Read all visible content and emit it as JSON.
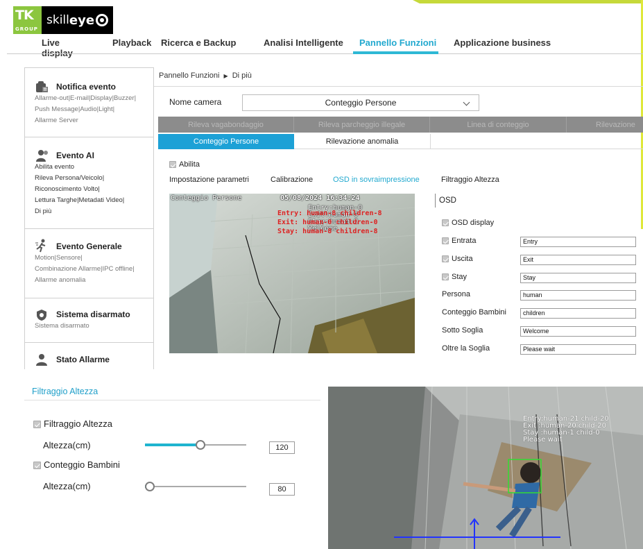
{
  "brand": {
    "logo_mark": "TK",
    "logo_group": "GROUP",
    "product_prefix": "skill",
    "product_name": "eye"
  },
  "main_nav": [
    {
      "label": "Live display"
    },
    {
      "label": "Playback"
    },
    {
      "label": "Ricerca e Backup"
    },
    {
      "label": "Analisi Intelligente"
    },
    {
      "label": "Pannello Funzioni",
      "active": true
    },
    {
      "label": "Applicazione business"
    }
  ],
  "sidebar": [
    {
      "title": "Notifica evento",
      "icon": "bell-icon",
      "items": [
        "Allarme-out|E-mail|Display|Buzzer|",
        "Push Message|Audio|Light|",
        "Allarme Server"
      ]
    },
    {
      "title": "Evento AI",
      "icon": "ai-person-icon",
      "items": [
        "Abilita evento",
        "Rileva Persona/Veicolo|",
        "Riconoscimento Volto|",
        "Lettura Targhe|Metadati Video|",
        "Di più"
      ]
    },
    {
      "title": "Evento Generale",
      "icon": "motion-person-icon",
      "items": [
        "Motion|Sensore|",
        "Combinazione Allarme|IPC offline|",
        "Allarme anomalia"
      ]
    },
    {
      "title": "Sistema disarmato",
      "icon": "shield-icon",
      "items": [
        "Sistema disarmato"
      ]
    },
    {
      "title": "Stato Allarme",
      "icon": "alarm-status-icon",
      "items": []
    }
  ],
  "breadcrumb": {
    "root": "Pannello Funzioni",
    "separator": "▶",
    "current": "Di più"
  },
  "camera": {
    "label": "Nome camera",
    "selected": "Conteggio Persone"
  },
  "tabs_row1": [
    "Rileva vagabondaggio",
    "Rileva parcheggio illegale",
    "Linea di conteggio",
    "Rilevazione"
  ],
  "tabs_row2": [
    {
      "label": "Conteggio Persone",
      "active": true
    },
    {
      "label": "Rilevazione anomalia",
      "active": false
    }
  ],
  "abilita": {
    "label": "Abilita",
    "checked": true
  },
  "subtabs": [
    {
      "label": "Impostazione parametri",
      "active": false
    },
    {
      "label": "Calibrazione",
      "active": false
    },
    {
      "label": "OSD in sovraimpressione",
      "active": true
    },
    {
      "label": "Filtraggio Altezza",
      "active": false
    }
  ],
  "video_overlay": {
    "channel": "Conteggio Persone",
    "timestamp": "05/08/2024 16:34:24",
    "red_lines": [
      "Entry: human-8 children-8",
      "Exit: human-0 children-0",
      "Stay: human-8 children-8"
    ],
    "white_lines": [
      "Entry:human-0",
      "Exit:human-0",
      "Stay:human-0",
      "Welcome"
    ]
  },
  "osd": {
    "title": "OSD",
    "display": {
      "label": "OSD display",
      "checked": true
    },
    "fields": [
      {
        "label": "Entrata",
        "checkbox": true,
        "value": "Entry"
      },
      {
        "label": "Uscita",
        "checkbox": true,
        "value": "Exit"
      },
      {
        "label": "Stay",
        "checkbox": true,
        "value": "Stay"
      },
      {
        "label": "Persona",
        "checkbox": false,
        "value": "human"
      },
      {
        "label": "Conteggio Bambini",
        "checkbox": false,
        "value": "children"
      },
      {
        "label": "Sotto Soglia",
        "checkbox": false,
        "value": "Welcome"
      },
      {
        "label": "Oltre la Soglia",
        "checkbox": false,
        "value": "Please wait"
      }
    ]
  },
  "height_filter": {
    "title": "Filtraggio Altezza",
    "filter": {
      "label": "Filtraggio Altezza",
      "checked": true
    },
    "height1": {
      "label": "Altezza(cm)",
      "value": "120",
      "level": 0.55
    },
    "children": {
      "label": "Conteggio Bambini",
      "checked": true
    },
    "height2": {
      "label": "Altezza(cm)",
      "value": "80",
      "level": 0.0
    }
  },
  "camera_overlay": {
    "lines": [
      "Entry:human-21 child-20",
      "Exit :human-20 child-20",
      "Stay :human-1 child-0",
      "Please wait"
    ]
  },
  "colors": {
    "accent": "#22a9cf",
    "tab_active": "#1da1d6",
    "detect_box": "#33dd33",
    "count_line": "#2233ff"
  }
}
